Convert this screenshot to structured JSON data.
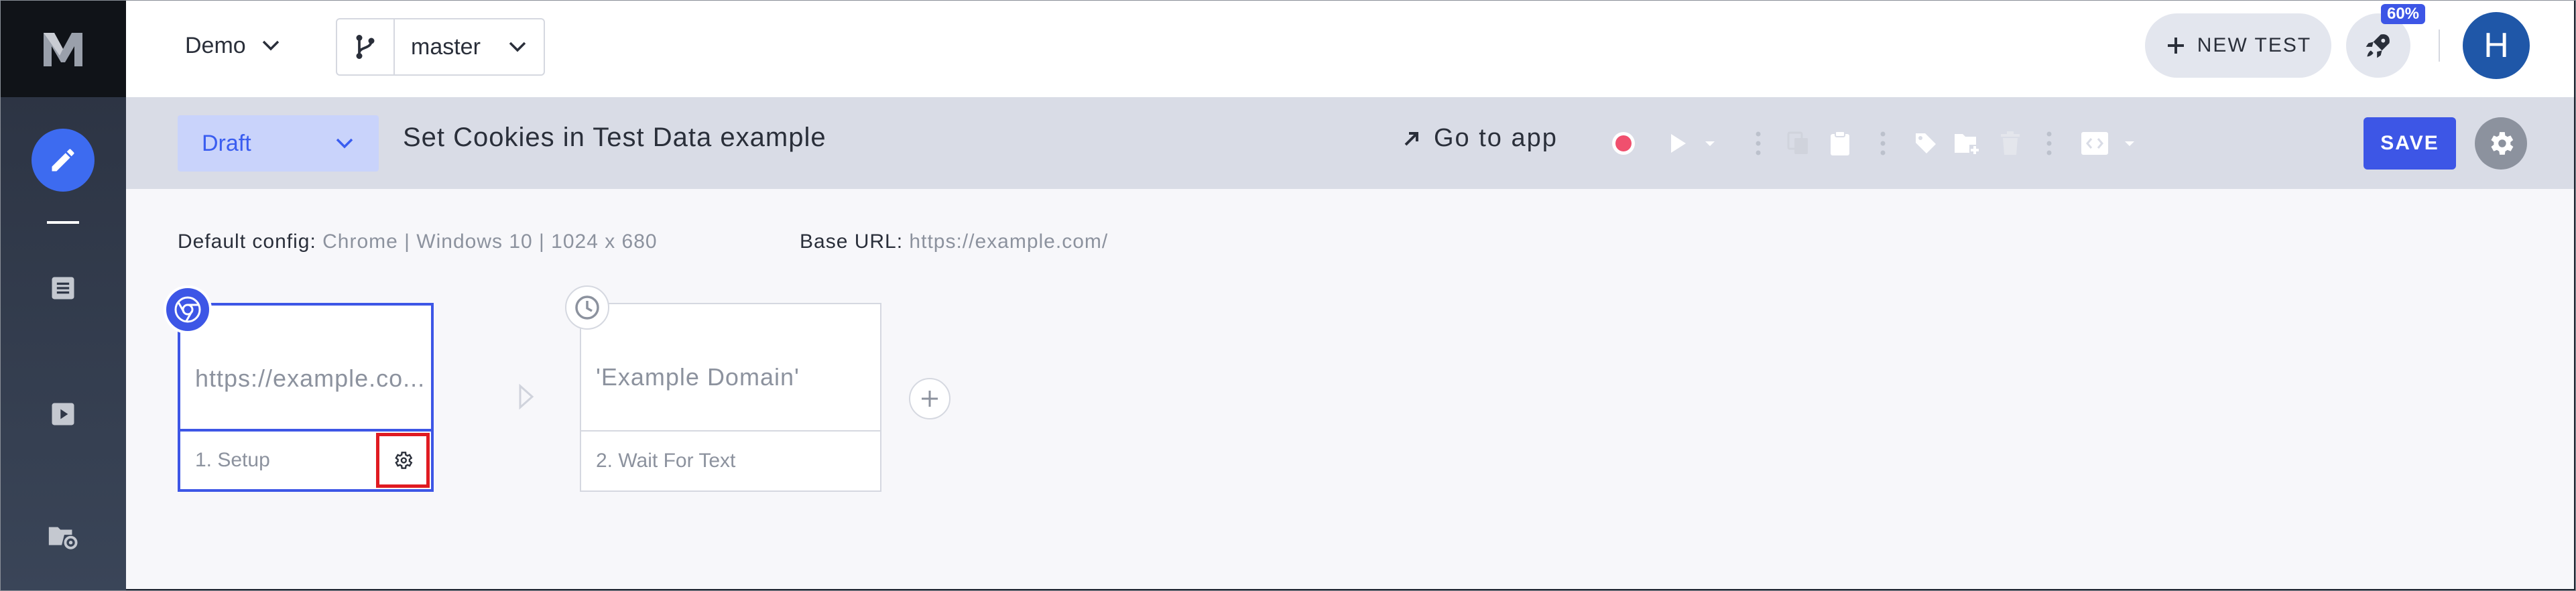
{
  "app": {
    "logo": "M",
    "logo_icon": "m-logo-icon"
  },
  "header": {
    "project": "Demo",
    "branch": "master",
    "new_test_label": "NEW TEST",
    "progress_badge": "60%",
    "avatar_initial": "H"
  },
  "toolbar": {
    "status": "Draft",
    "test_title": "Set Cookies in Test Data example",
    "go_to_app": "Go to app",
    "save_label": "SAVE",
    "record_color": "#f0506e"
  },
  "config": {
    "default_config_label": "Default config:",
    "default_config_value": "Chrome | Windows 10 | 1024 x 680",
    "base_url_label": "Base URL:",
    "base_url_value": "https://example.com/"
  },
  "steps": [
    {
      "text": "https://example.co...",
      "footer": "1. Setup",
      "icon": "chrome-icon"
    },
    {
      "text": "'Example Domain'",
      "footer": "2. Wait For Text",
      "icon": "clock-icon"
    }
  ],
  "colors": {
    "accent": "#3d56e6",
    "highlight": "#e01b22"
  }
}
